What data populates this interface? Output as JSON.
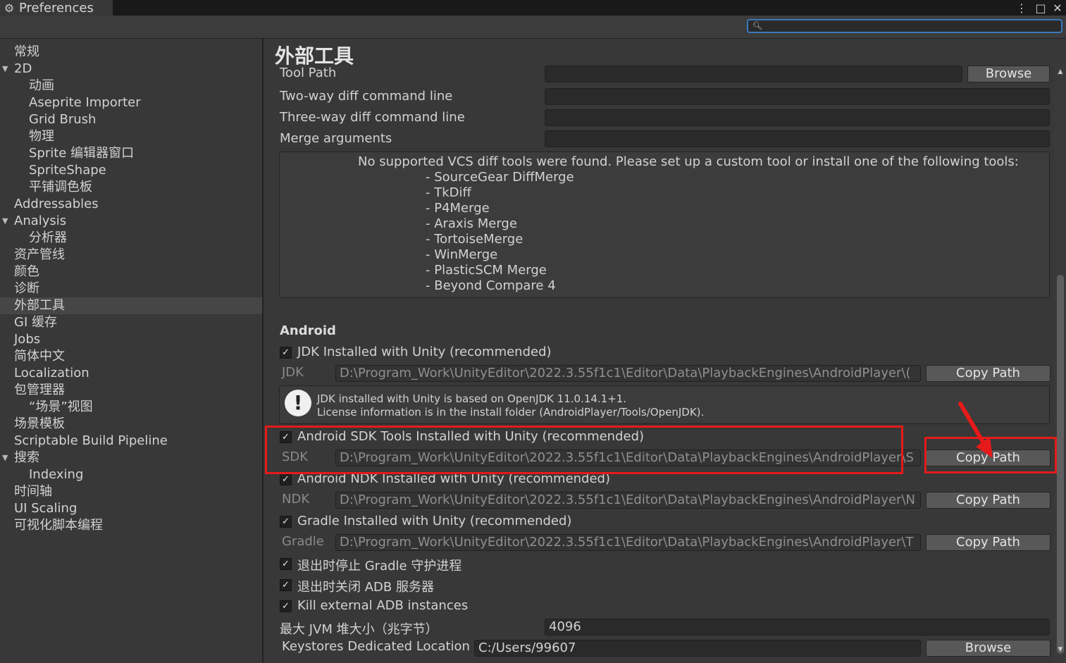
{
  "window": {
    "title": "Preferences",
    "tab_icon": "gear-icon",
    "menu_icon": "⋮",
    "maximize_icon": "□",
    "close_icon": "✕"
  },
  "search": {
    "placeholder": "",
    "icon": "magnifier-icon"
  },
  "sidebar": {
    "items": [
      {
        "label": "常规",
        "indent": 0
      },
      {
        "label": "2D",
        "indent": 0,
        "expanded": true
      },
      {
        "label": "动画",
        "indent": 1
      },
      {
        "label": "Aseprite Importer",
        "indent": 1
      },
      {
        "label": "Grid Brush",
        "indent": 1
      },
      {
        "label": "物理",
        "indent": 1
      },
      {
        "label": "Sprite 编辑器窗口",
        "indent": 1
      },
      {
        "label": "SpriteShape",
        "indent": 1
      },
      {
        "label": "平铺调色板",
        "indent": 1
      },
      {
        "label": "Addressables",
        "indent": 0
      },
      {
        "label": "Analysis",
        "indent": 0,
        "expanded": true
      },
      {
        "label": "分析器",
        "indent": 1
      },
      {
        "label": "资产管线",
        "indent": 0
      },
      {
        "label": "颜色",
        "indent": 0
      },
      {
        "label": "诊断",
        "indent": 0
      },
      {
        "label": "外部工具",
        "indent": 0,
        "selected": true
      },
      {
        "label": "GI 缓存",
        "indent": 0
      },
      {
        "label": "Jobs",
        "indent": 0
      },
      {
        "label": "简体中文",
        "indent": 0
      },
      {
        "label": "Localization",
        "indent": 0
      },
      {
        "label": "包管理器",
        "indent": 0
      },
      {
        "label": "“场景”视图",
        "indent": 1
      },
      {
        "label": "场景模板",
        "indent": 0
      },
      {
        "label": "Scriptable Build Pipeline",
        "indent": 0
      },
      {
        "label": "搜索",
        "indent": 0,
        "expanded": true
      },
      {
        "label": "Indexing",
        "indent": 1
      },
      {
        "label": "时间轴",
        "indent": 0
      },
      {
        "label": "UI Scaling",
        "indent": 0
      },
      {
        "label": "可视化脚本编程",
        "indent": 0
      }
    ]
  },
  "main": {
    "title": "外部工具",
    "tool_path": {
      "label": "Tool Path",
      "value": "",
      "button": "Browse"
    },
    "two_way": {
      "label": "Two-way diff command line",
      "value": ""
    },
    "three_way": {
      "label": "Three-way diff command line",
      "value": ""
    },
    "merge_args": {
      "label": "Merge arguments",
      "value": ""
    },
    "vcs_message": "No supported VCS diff tools were found. Please set up a custom tool or install one of the following tools:",
    "vcs_tools": [
      "- SourceGear DiffMerge",
      "- TkDiff",
      "- P4Merge",
      "- Araxis Merge",
      "- TortoiseMerge",
      "- WinMerge",
      "- PlasticSCM Merge",
      "- Beyond Compare 4"
    ],
    "android": {
      "header": "Android",
      "jdk_check": {
        "label": "JDK Installed with Unity (recommended)",
        "checked": true
      },
      "jdk": {
        "label": "JDK",
        "value": "D:\\Program_Work\\UnityEditor\\2022.3.55f1c1\\Editor\\Data\\PlaybackEngines\\AndroidPlayer\\(",
        "button": "Copy Path"
      },
      "jdk_info_line1": "JDK installed with Unity is based on OpenJDK 11.0.14.1+1.",
      "jdk_info_line2": "License information is in the install folder (AndroidPlayer/Tools/OpenJDK).",
      "sdk_check": {
        "label": "Android SDK Tools Installed with Unity (recommended)",
        "checked": true
      },
      "sdk": {
        "label": "SDK",
        "value": "D:\\Program_Work\\UnityEditor\\2022.3.55f1c1\\Editor\\Data\\PlaybackEngines\\AndroidPlayer\\S",
        "button": "Copy Path"
      },
      "ndk_check": {
        "label": "Android NDK Installed with Unity (recommended)",
        "checked": true
      },
      "ndk": {
        "label": "NDK",
        "value": "D:\\Program_Work\\UnityEditor\\2022.3.55f1c1\\Editor\\Data\\PlaybackEngines\\AndroidPlayer\\N",
        "button": "Copy Path"
      },
      "gradle_check": {
        "label": "Gradle Installed with Unity (recommended)",
        "checked": true
      },
      "gradle": {
        "label": "Gradle",
        "value": "D:\\Program_Work\\UnityEditor\\2022.3.55f1c1\\Editor\\Data\\PlaybackEngines\\AndroidPlayer\\T",
        "button": "Copy Path"
      },
      "stop_gradle": {
        "label": "退出时停止 Gradle 守护进程",
        "checked": true
      },
      "close_adb": {
        "label": "退出时关闭 ADB 服务器",
        "checked": true
      },
      "kill_adb": {
        "label": "Kill external ADB instances",
        "checked": true
      },
      "jvm": {
        "label": "最大 JVM 堆大小（兆字节）",
        "value": "4096"
      },
      "keystores": {
        "label": "Keystores Dedicated Location",
        "value": "C:/Users/99607",
        "button": "Browse"
      }
    }
  },
  "colors": {
    "background": "#383838",
    "highlight": "#e61a1a",
    "search_border": "#3a79bb"
  }
}
